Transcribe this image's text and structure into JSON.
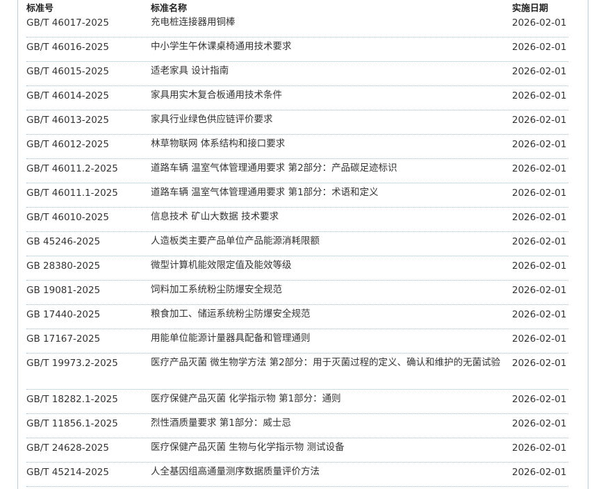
{
  "table": {
    "headers": {
      "code": "标准号",
      "name": "标准名称",
      "date": "实施日期"
    },
    "rows": [
      {
        "code": "GB/T 46017-2025",
        "name": "充电桩连接器用铜棒",
        "date": "2026-02-01"
      },
      {
        "code": "GB/T 46016-2025",
        "name": "中小学生午休课桌椅通用技术要求",
        "date": "2026-02-01"
      },
      {
        "code": "GB/T 46015-2025",
        "name": "适老家具 设计指南",
        "date": "2026-02-01"
      },
      {
        "code": "GB/T 46014-2025",
        "name": "家具用实木复合板通用技术条件",
        "date": "2026-02-01"
      },
      {
        "code": "GB/T 46013-2025",
        "name": "家具行业绿色供应链评价要求",
        "date": "2026-02-01"
      },
      {
        "code": "GB/T 46012-2025",
        "name": "林草物联网 体系结构和接口要求",
        "date": "2026-02-01"
      },
      {
        "code": "GB/T 46011.2-2025",
        "name": "道路车辆 温室气体管理通用要求 第2部分：产品碳足迹标识",
        "date": "2026-02-01"
      },
      {
        "code": "GB/T 46011.1-2025",
        "name": "道路车辆 温室气体管理通用要求 第1部分：术语和定义",
        "date": "2026-02-01"
      },
      {
        "code": "GB/T 46010-2025",
        "name": "信息技术 矿山大数据 技术要求",
        "date": "2026-02-01"
      },
      {
        "code": "GB 45246-2025",
        "name": "人造板类主要产品单位产品能源消耗限额",
        "date": "2026-02-01"
      },
      {
        "code": "GB 28380-2025",
        "name": "微型计算机能效限定值及能效等级",
        "date": "2026-02-01"
      },
      {
        "code": "GB 19081-2025",
        "name": "饲料加工系统粉尘防爆安全规范",
        "date": "2026-02-01"
      },
      {
        "code": "GB 17440-2025",
        "name": "粮食加工、储运系统粉尘防爆安全规范",
        "date": "2026-02-01"
      },
      {
        "code": "GB 17167-2025",
        "name": "用能单位能源计量器具配备和管理通则",
        "date": "2026-02-01"
      },
      {
        "code": "GB/T 19973.2-2025",
        "name": "医疗产品灭菌 微生物学方法 第2部分：用于灭菌过程的定义、确认和维护的无菌试验",
        "date": "2026-02-01"
      },
      {
        "code": "GB/T 18282.1-2025",
        "name": "医疗保健产品灭菌 化学指示物 第1部分：通则",
        "date": "2026-02-01"
      },
      {
        "code": "GB/T 11856.1-2025",
        "name": "烈性酒质量要求 第1部分：威士忌",
        "date": "2026-02-01"
      },
      {
        "code": "GB/T 24628-2025",
        "name": "医疗保健产品灭菌 生物与化学指示物 测试设备",
        "date": "2026-02-01"
      },
      {
        "code": "GB/T 45214-2025",
        "name": "人全基因组高通量测序数据质量评价方法",
        "date": "2026-02-01"
      }
    ]
  }
}
